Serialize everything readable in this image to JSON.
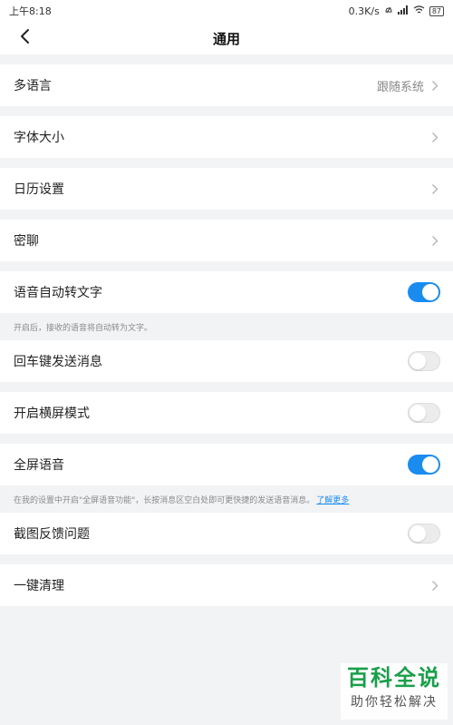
{
  "status_bar": {
    "time": "上午8:18",
    "network_speed": "0.3K/s",
    "battery": "87"
  },
  "header": {
    "title": "通用",
    "back_icon": "chevron-left-icon"
  },
  "settings": {
    "language": {
      "label": "多语言",
      "value": "跟随系统"
    },
    "font_size": {
      "label": "字体大小"
    },
    "calendar": {
      "label": "日历设置"
    },
    "secret_chat": {
      "label": "密聊"
    },
    "voice_to_text": {
      "label": "语音自动转文字",
      "enabled": true,
      "hint": "开启后，接收的语音将自动转为文字。"
    },
    "enter_send": {
      "label": "回车键发送消息",
      "enabled": false
    },
    "landscape": {
      "label": "开启横屏模式",
      "enabled": false
    },
    "fullscreen_voice": {
      "label": "全屏语音",
      "enabled": true,
      "hint": "在我的设置中开启\"全屏语音功能\"，长按消息区空白处即可更快捷的发送语音消息。",
      "hint_link": "了解更多"
    },
    "screenshot_feedback": {
      "label": "截图反馈问题",
      "enabled": false
    },
    "one_key_clean": {
      "label": "一键清理"
    }
  },
  "watermark": {
    "title": "百科全说",
    "subtitle": "助你轻松解决"
  },
  "colors": {
    "accent": "#1a8cf0",
    "background": "#f2f3f5",
    "watermark_green": "#1a9f4a"
  }
}
